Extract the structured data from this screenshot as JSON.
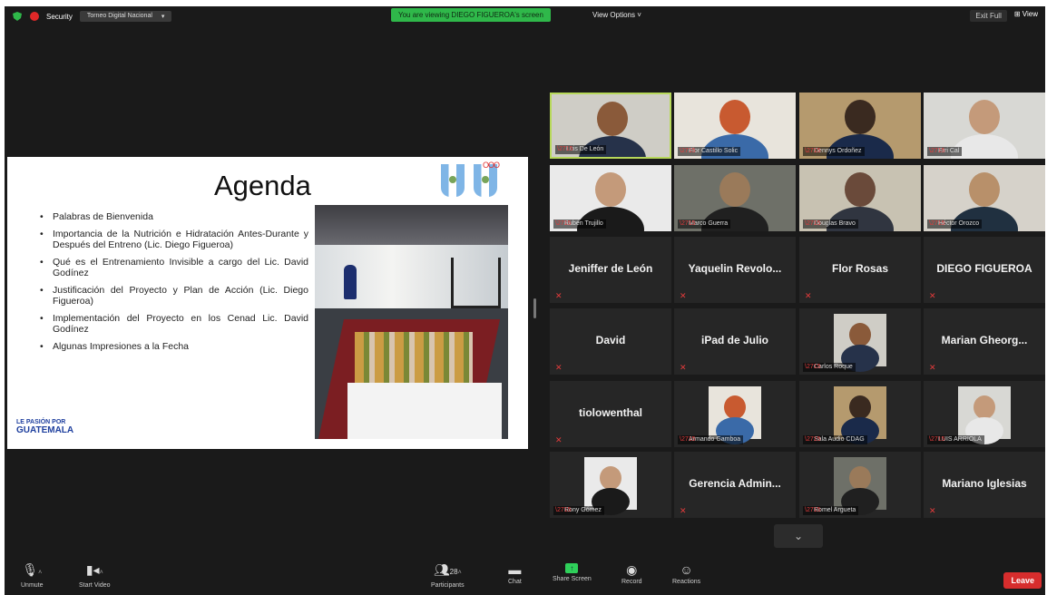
{
  "topbar": {
    "security_label": "Security",
    "dropdown_label": "Torneo Digital Nacional",
    "viewing_banner": "You are viewing DIEGO FIGUEROA's screen",
    "view_options": "View Options ˅",
    "exit_fullscreen": "Exit Full",
    "layout_label": "View"
  },
  "slide": {
    "title": "Agenda",
    "items": [
      "Palabras de Bienvenida",
      "Importancia de la Nutrición e Hidratación Antes-Durante y Después del Entreno (Lic. Diego Figueroa)",
      "Qué es el Entrenamiento Invisible a cargo del Lic. David Godínez",
      "Justificación del Proyecto y Plan de Acción (Lic. Diego Figueroa)",
      "Implementación del Proyecto en los Cenad Lic. David Godínez",
      "Algunas Impresiones a la Fecha"
    ],
    "brand_top": "LE PASIÓN POR",
    "brand_bottom": "GUATEMALA",
    "rings": "OOO"
  },
  "gallery": {
    "tiles": [
      {
        "kind": "video",
        "label": "Luis De León",
        "active": true
      },
      {
        "kind": "video",
        "label": "Flor Castillo Solic"
      },
      {
        "kind": "video",
        "label": "Dennys Ordoñez"
      },
      {
        "kind": "video",
        "label": "Erri Cal"
      },
      {
        "kind": "video",
        "label": "Rubén Trujillo"
      },
      {
        "kind": "video",
        "label": "Marco Guerra"
      },
      {
        "kind": "video",
        "label": "Douglas Bravo"
      },
      {
        "kind": "video",
        "label": "Héctor Orozco"
      },
      {
        "kind": "name",
        "name": "Jeniffer de León"
      },
      {
        "kind": "name",
        "name": "Yaquelin Revolo..."
      },
      {
        "kind": "name",
        "name": "Flor Rosas"
      },
      {
        "kind": "name",
        "name": "DIEGO FIGUEROA"
      },
      {
        "kind": "name",
        "name": "David"
      },
      {
        "kind": "name",
        "name": "iPad de Julio"
      },
      {
        "kind": "video",
        "label": "Carlos Roque"
      },
      {
        "kind": "name",
        "name": "Marian Gheorg..."
      },
      {
        "kind": "name",
        "name": "tiolowenthal"
      },
      {
        "kind": "video",
        "label": "Armando Gamboa"
      },
      {
        "kind": "video",
        "label": "Sala Audio CDAG"
      },
      {
        "kind": "video",
        "label": "LUIS ARRIOLA"
      },
      {
        "kind": "video",
        "label": "Rony Gómez"
      },
      {
        "kind": "name",
        "name": "Gerencia Admin..."
      },
      {
        "kind": "video",
        "label": "Romel Argueta"
      },
      {
        "kind": "name",
        "name": "Mariano Iglesias"
      }
    ]
  },
  "toolbar": {
    "unmute": "Unmute",
    "start_video": "Start Video",
    "participants": "Participants",
    "participants_count": "28",
    "chat": "Chat",
    "share_screen": "Share Screen",
    "record": "Record",
    "reactions": "Reactions",
    "leave": "Leave"
  },
  "colors": {
    "background": "#1a1a1a",
    "banner_green": "#2fb84a",
    "active_speaker_border": "#b7d85a",
    "leave_red": "#d72d2d",
    "muted_red": "#e23b3b"
  }
}
